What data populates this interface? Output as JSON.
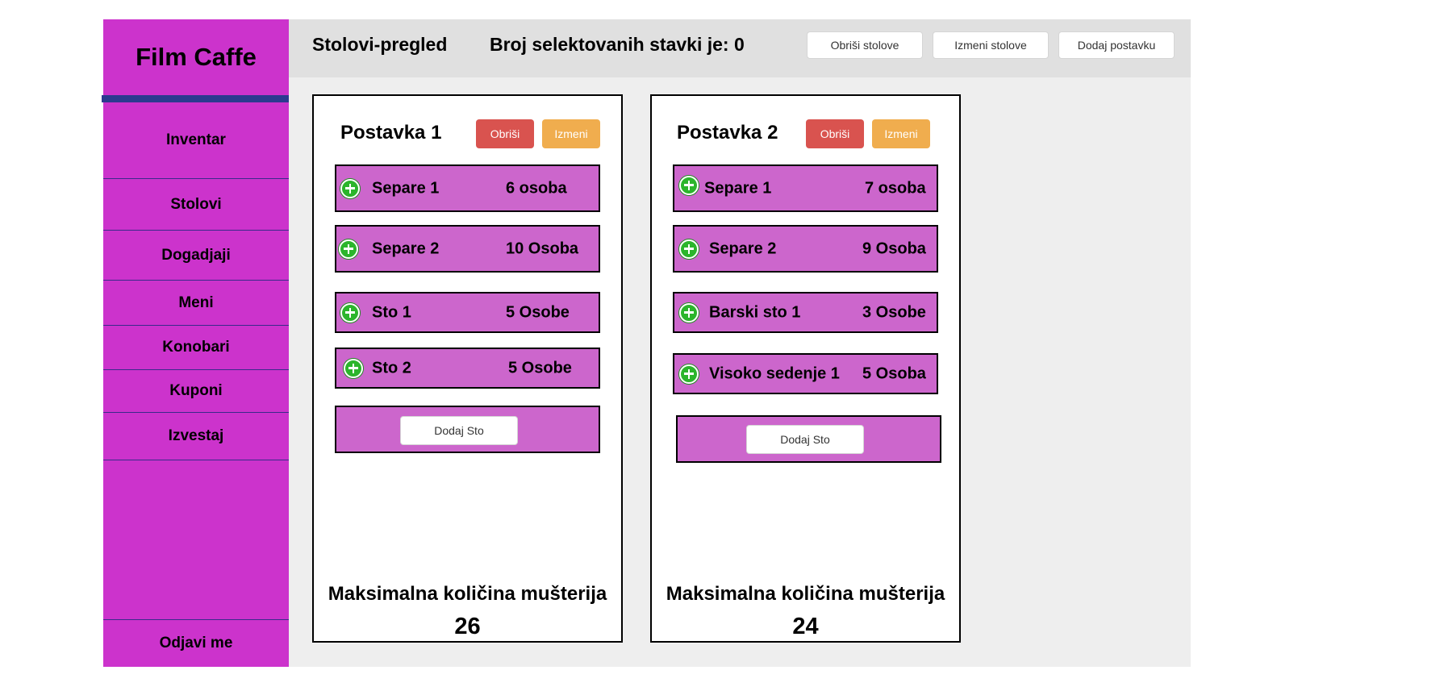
{
  "app": {
    "title": "Film Caffe"
  },
  "sidebar": {
    "items": [
      {
        "label": "Inventar"
      },
      {
        "label": "Stolovi"
      },
      {
        "label": "Dogadjaji"
      },
      {
        "label": "Meni"
      },
      {
        "label": "Konobari"
      },
      {
        "label": "Kuponi"
      },
      {
        "label": "Izvestaj"
      }
    ],
    "logout_label": "Odjavi me"
  },
  "header": {
    "page_title": "Stolovi-pregled",
    "selected_count_text": "Broj selektovanih stavki je: 0",
    "buttons": {
      "delete_tables": "Obriši stolove",
      "edit_tables": "Izmeni stolove",
      "add_setup": "Dodaj postavku"
    }
  },
  "setups": [
    {
      "title": "Postavka 1",
      "delete_label": "Obriši",
      "edit_label": "Izmeni",
      "tables": [
        {
          "name": "Separe 1",
          "capacity": "6 osoba"
        },
        {
          "name": "Separe 2",
          "capacity": "10 Osoba"
        },
        {
          "name": "Sto 1",
          "capacity": "5 Osobe"
        },
        {
          "name": "Sto 2",
          "capacity": "5 Osobe"
        }
      ],
      "add_table_label": "Dodaj Sto",
      "max_label": "Maksimalna količina mušterija",
      "max_value": "26"
    },
    {
      "title": "Postavka 2",
      "delete_label": "Obriši",
      "edit_label": "Izmeni",
      "tables": [
        {
          "name": "Separe 1",
          "capacity": "7 osoba"
        },
        {
          "name": "Separe 2",
          "capacity": "9 Osoba"
        },
        {
          "name": "Barski sto 1",
          "capacity": "3 Osobe"
        },
        {
          "name": "Visoko sedenje 1",
          "capacity": "5 Osoba"
        }
      ],
      "add_table_label": "Dodaj Sto",
      "max_label": "Maksimalna količina mušterija",
      "max_value": "24"
    }
  ],
  "colors": {
    "sidebar": "#cc33cc",
    "table_row": "#cc66cc",
    "accent_bar": "#2b3a8f",
    "delete": "#d9534f",
    "edit": "#f0ad4e",
    "plus_icon": "#2bb52b"
  }
}
